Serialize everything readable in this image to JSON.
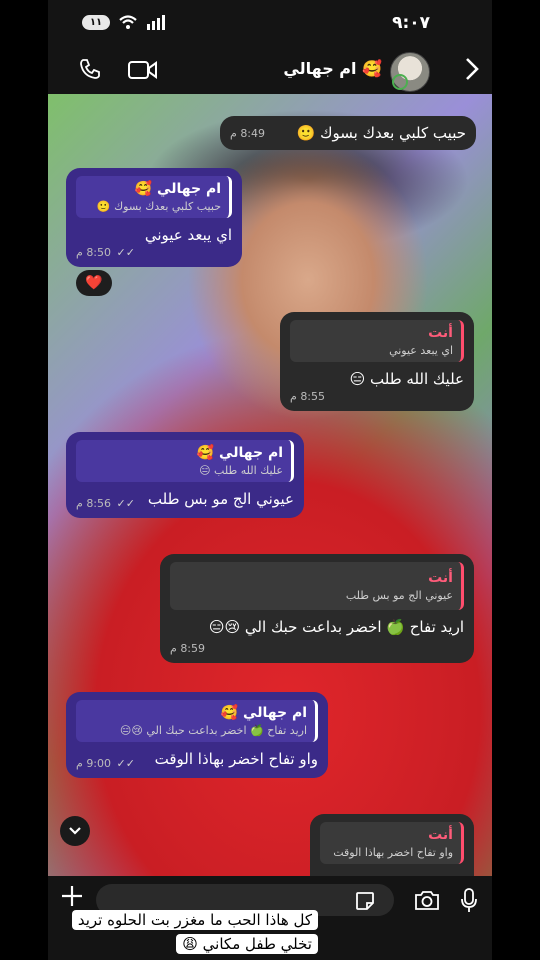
{
  "status": {
    "time": "٩:٠٧",
    "battery": "١١"
  },
  "header": {
    "contact_name": "ام جهالي 🥰"
  },
  "messages": [
    {
      "text": "حبيب كلبي بعدك بسوك 🙂",
      "time": "8:49 م"
    },
    {
      "reply_name": "ام جهالي 🥰",
      "reply_text": "حبيب كلبي بعدك بسوك 🙂",
      "text": "اي يبعد عيوني",
      "time": "8:50 م",
      "reaction": "❤️"
    },
    {
      "reply_name": "أنت",
      "reply_text": "اي يبعد عيوني",
      "text": "عليك الله طلب 😑",
      "time": "8:55 م"
    },
    {
      "reply_name": "ام جهالي 🥰",
      "reply_text": "عليك الله طلب 😑",
      "text": "عيوني الج مو بس طلب",
      "time": "8:56 م"
    },
    {
      "reply_name": "أنت",
      "reply_text": "عيوني الج مو بس طلب",
      "text": "اريد تفاح 🍏 اخضر بداعت حبك الي 😢😑",
      "time": "8:59 م"
    },
    {
      "reply_name": "ام جهالي 🥰",
      "reply_text": "اريد تفاح 🍏 اخضر بداعت حبك الي 😢😑",
      "text": "واو تفاح اخضر بهاذا الوقت",
      "time": "9:00 م"
    },
    {
      "reply_name": "أنت",
      "reply_text": "واو تفاح اخضر بهاذا الوقت"
    }
  ],
  "caption": "كل هاذا الحب ما مغزر بت الحلوه تريد تخلي طفل مكاني 😩",
  "icons": [
    "phone-icon",
    "video-icon",
    "back-icon",
    "scroll-down-icon",
    "plus-icon",
    "sticker-icon",
    "camera-icon",
    "mic-icon",
    "wifi-icon",
    "signal-icon",
    "double-check-icon"
  ]
}
